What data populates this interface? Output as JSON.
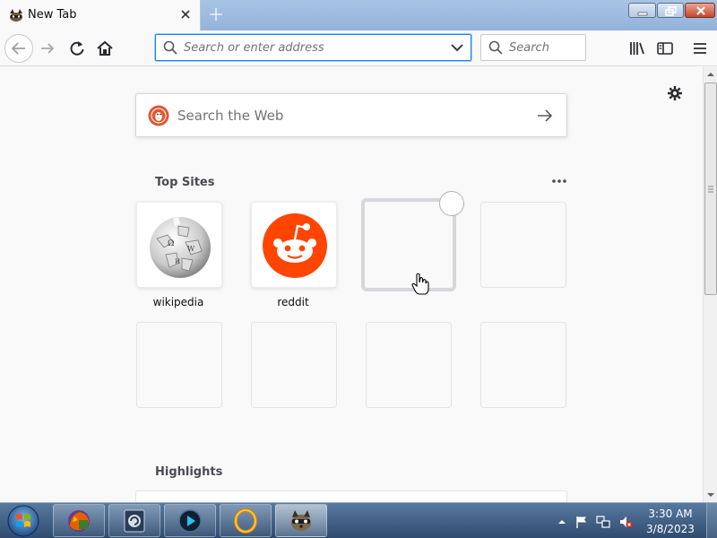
{
  "browser": {
    "tab": {
      "title": "New Tab",
      "close_icon": "close-icon",
      "favicon": "firefox-raccoon-icon"
    },
    "new_tab_icon": "plus-icon",
    "window_controls": [
      "minimize",
      "maximize",
      "close"
    ]
  },
  "navbar": {
    "back_icon": "back-arrow-icon",
    "forward_icon": "forward-arrow-icon",
    "reload_icon": "reload-icon",
    "home_icon": "home-icon",
    "url_placeholder": "Search or enter address",
    "search_placeholder": "Search",
    "right_icons": [
      "library-icon",
      "sidebar-icon",
      "menu-icon"
    ]
  },
  "newtab": {
    "web_search_placeholder": "Search the Web",
    "search_engine_icon": "duckduckgo-icon",
    "top_sites_title": "Top Sites",
    "highlights_title": "Highlights",
    "top_sites": [
      {
        "label": "wikipedia",
        "icon": "wikipedia-globe-icon"
      },
      {
        "label": "reddit",
        "icon": "reddit-icon"
      }
    ],
    "empty_tile_count": 6
  },
  "taskbar": {
    "pinned": [
      "firefox-icon",
      "windows-update-icon",
      "media-player-icon",
      "lord-of-rings-icon",
      "raccoon-icon"
    ],
    "tray": [
      "chevron-up-icon",
      "flag-icon",
      "network-icon",
      "volume-muted-icon"
    ],
    "time": "3:30 AM",
    "date": "3/8/2023"
  },
  "colors": {
    "accent": "#0a84ff",
    "reddit": "#ff4500",
    "duckduckgo": "#de5833"
  }
}
